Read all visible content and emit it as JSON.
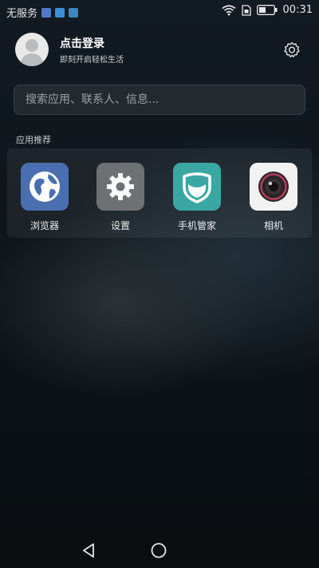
{
  "status_bar": {
    "carrier": "无服务",
    "time": "00:31",
    "notification_icons": [
      "message-app-icon",
      "browser-app-icon",
      "assistant-app-icon"
    ],
    "right_icons": [
      "wifi-icon",
      "sim-icon",
      "battery-icon"
    ]
  },
  "account": {
    "title": "点击登录",
    "subtitle": "即刻开启轻松生活"
  },
  "search": {
    "placeholder": "搜索应用、联系人、信息..."
  },
  "recommended": {
    "label": "应用推荐",
    "apps": [
      {
        "label": "浏览器",
        "icon": "browser-globe-icon",
        "color": "#4a6fb0"
      },
      {
        "label": "设置",
        "icon": "settings-gear-icon",
        "color": "#6e7174"
      },
      {
        "label": "手机管家",
        "icon": "phone-manager-shield-icon",
        "color": "#3aa7a3"
      },
      {
        "label": "相机",
        "icon": "camera-lens-icon",
        "color": "#f2f2f2"
      }
    ]
  },
  "navbar": {
    "buttons": [
      "back-icon",
      "home-icon"
    ]
  }
}
